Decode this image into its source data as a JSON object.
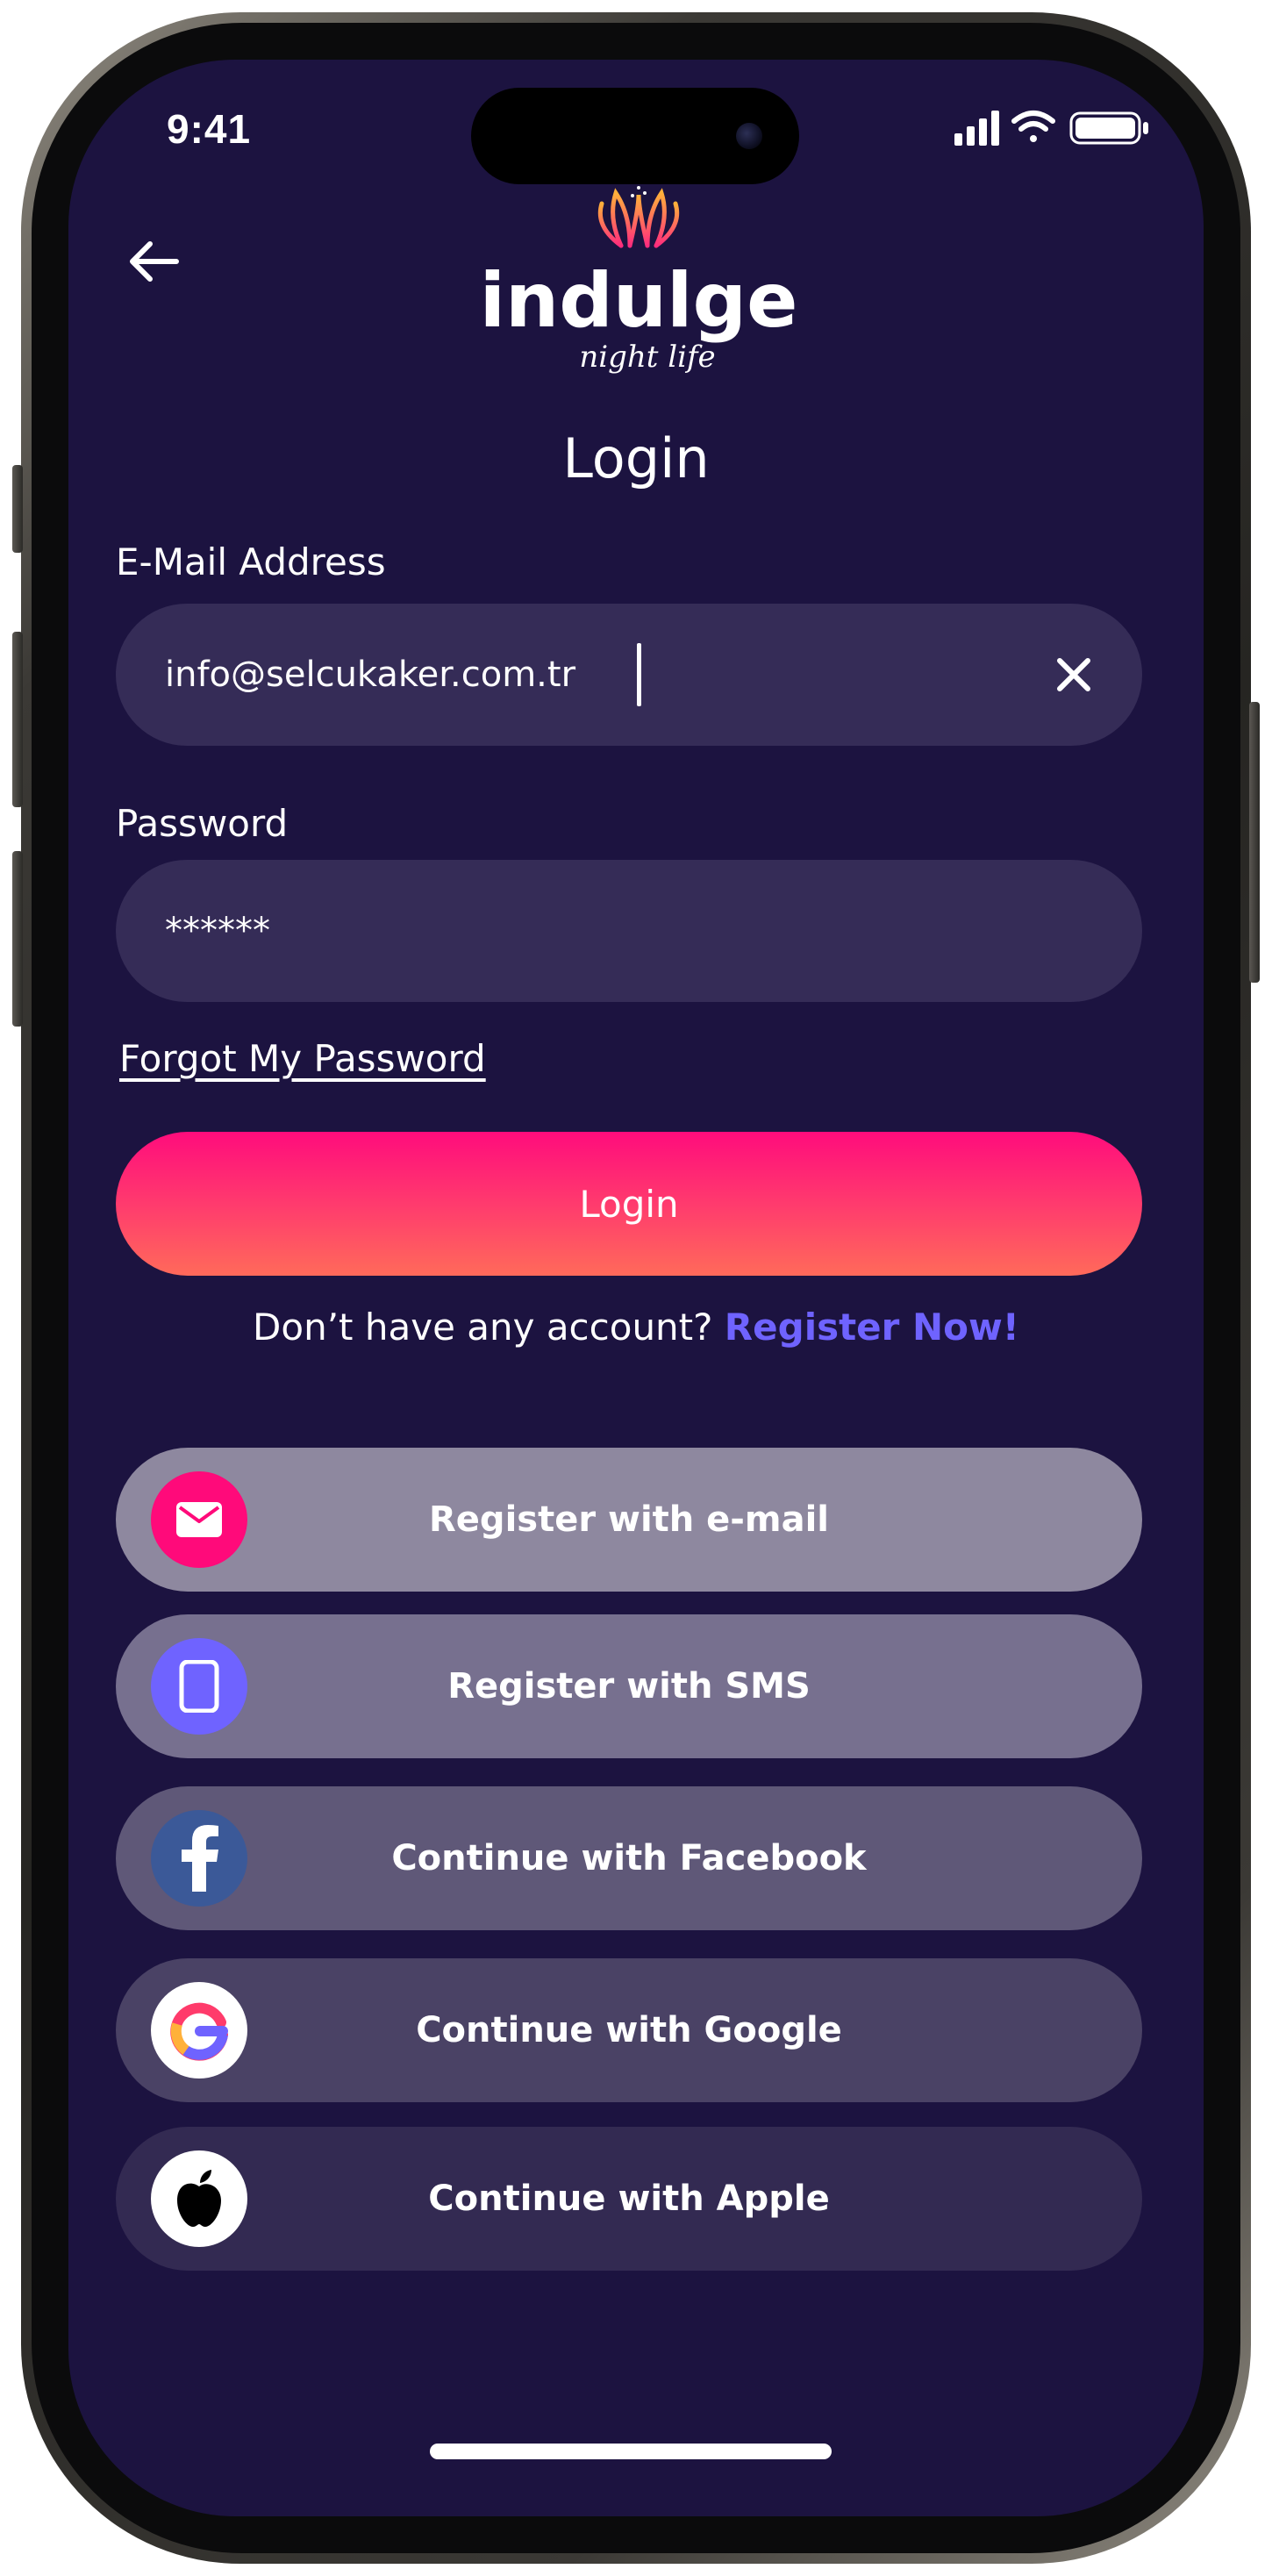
{
  "status_bar": {
    "time": "9:41",
    "icons": [
      "cellular-signal-icon",
      "wifi-icon",
      "battery-icon"
    ]
  },
  "header": {
    "back_icon": "arrow-left-icon",
    "logo_text": "indulge",
    "logo_tagline": "night life",
    "title": "Login"
  },
  "form": {
    "email_label": "E-Mail Address",
    "email_value": "info@selcukaker.com.tr",
    "clear_icon": "close-icon",
    "password_label": "Password",
    "password_value": "******",
    "forgot_link": "Forgot My Password",
    "login_button": "Login"
  },
  "register": {
    "prompt": "Don’t have any account?",
    "link": "Register Now!"
  },
  "social": [
    {
      "label": "Register with e-mail",
      "icon": "mail-icon",
      "icon_bg": "#ff0a7a",
      "button_bg": "#8e889f"
    },
    {
      "label": "Register with SMS",
      "icon": "phone-icon",
      "icon_bg": "#6f63ff",
      "button_bg": "#77708f"
    },
    {
      "label": "Continue with Facebook",
      "icon": "facebook-icon",
      "icon_bg": "#3b5998",
      "button_bg": "#5f5878"
    },
    {
      "label": "Continue with Google",
      "icon": "google-icon",
      "icon_bg": "#ffffff",
      "button_bg": "#4a4265"
    },
    {
      "label": "Continue with Apple",
      "icon": "apple-icon",
      "icon_bg": "#ffffff",
      "button_bg": "#332a52"
    }
  ],
  "colors": {
    "background": "#1c1340",
    "input_bg": "#352c57",
    "accent_pink": "#ff0c7c",
    "accent_coral": "#ff6a5a",
    "link_purple": "#6f63ff"
  }
}
